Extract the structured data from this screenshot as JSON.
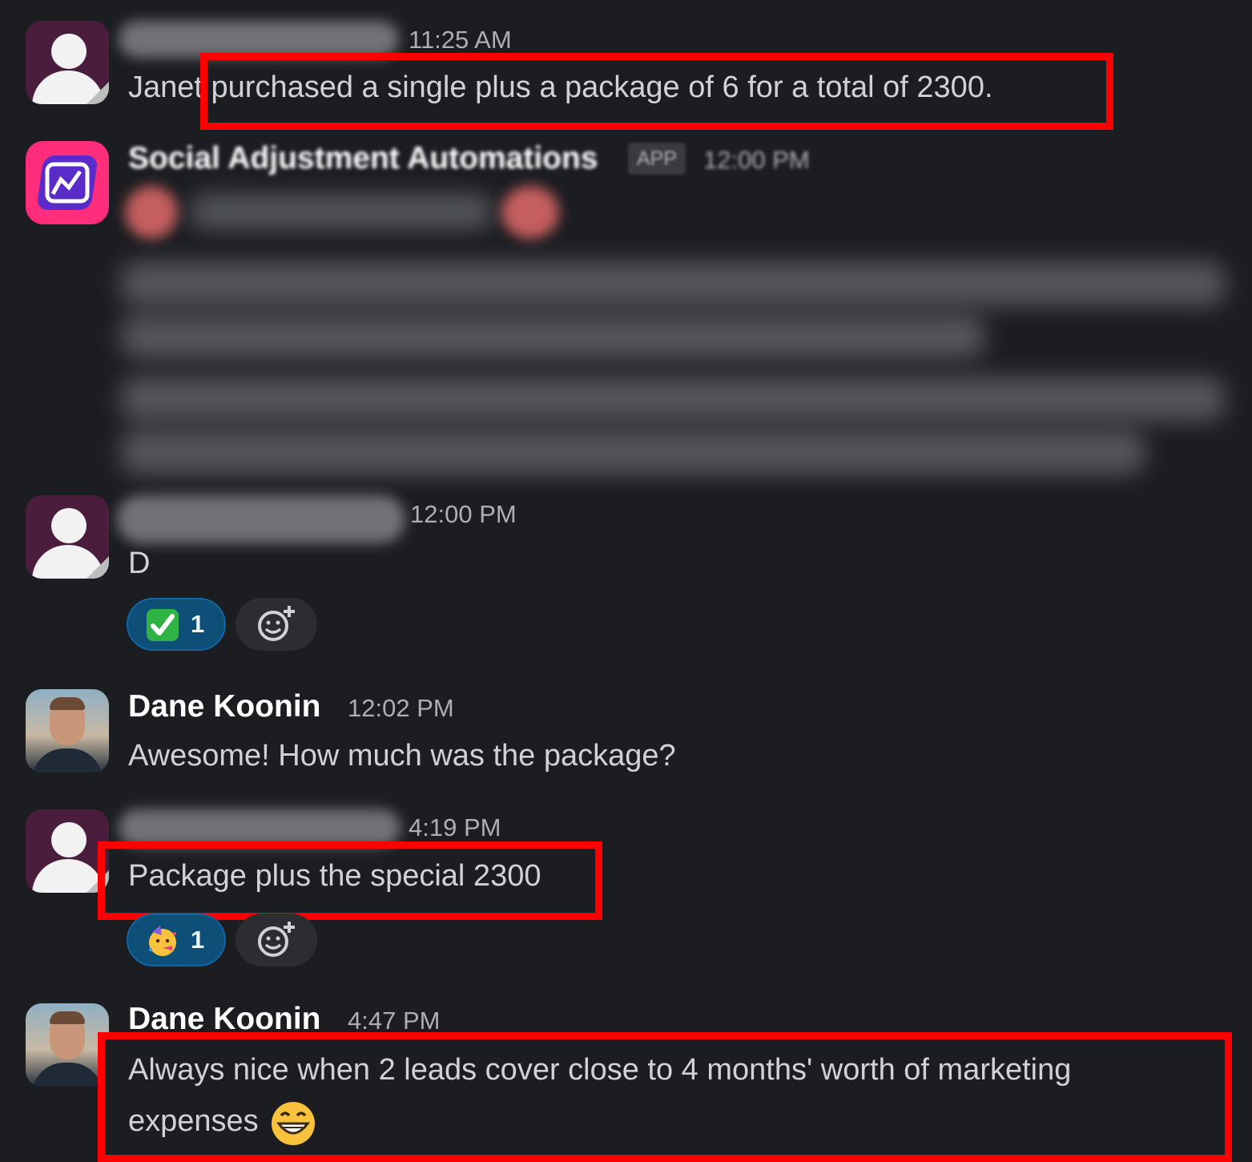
{
  "messages": [
    {
      "sender_visible": false,
      "time": "11:25 AM",
      "text": "Janet purchased a single plus a package of 6 for a total of 2300."
    },
    {
      "sender": "Social Adjustment Automations",
      "badge": "APP",
      "time": "12:00 PM",
      "content_blurred": true
    },
    {
      "sender_visible": false,
      "time": "12:00 PM",
      "text": "D",
      "reactions": [
        {
          "emoji_icon": "check-mark-icon",
          "count": "1"
        }
      ]
    },
    {
      "sender": "Dane Koonin",
      "time": "12:02 PM",
      "text": "Awesome! How much was the package?"
    },
    {
      "sender_visible": false,
      "time": "4:19 PM",
      "text": "Package plus the special 2300",
      "reactions": [
        {
          "emoji_icon": "partying-face-icon",
          "count": "1"
        }
      ]
    },
    {
      "sender": "Dane Koonin",
      "time": "4:47 PM",
      "text_line1": "Always nice when 2 leads cover close to 4 months' worth of marketing",
      "text_line2": "expenses",
      "trailing_emoji_icon": "grinning-face-icon"
    }
  ],
  "colors": {
    "background": "#1b1d21",
    "highlight_box": "#ff0000",
    "reaction_bg": "#0d4f76"
  }
}
